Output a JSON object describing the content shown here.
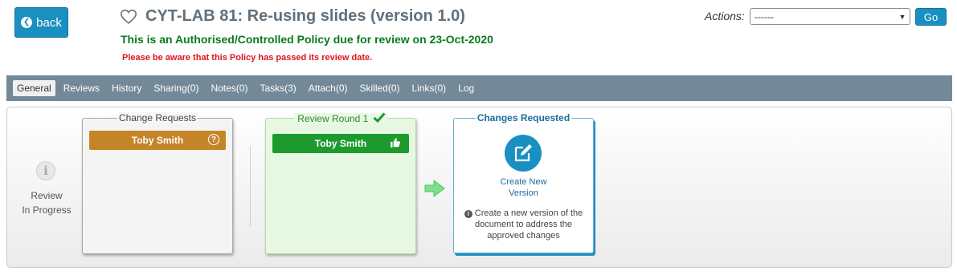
{
  "header": {
    "back_label": "back",
    "title": "CYT-LAB 81: Re-using slides (version 1.0)",
    "policy_status": "This is an Authorised/Controlled Policy due for review on 23-Oct-2020",
    "warning": "Please be aware that this Policy has passed its review date."
  },
  "actions": {
    "label": "Actions:",
    "selected": "------",
    "go_label": "Go"
  },
  "tabs": [
    {
      "label": "General",
      "active": true
    },
    {
      "label": "Reviews"
    },
    {
      "label": "History"
    },
    {
      "label": "Sharing(0)"
    },
    {
      "label": "Notes(0)"
    },
    {
      "label": "Tasks(3)"
    },
    {
      "label": "Attach(0)"
    },
    {
      "label": "Skilled(0)"
    },
    {
      "label": "Links(0)"
    },
    {
      "label": "Log"
    }
  ],
  "status": {
    "icon_letter": "i",
    "line1": "Review",
    "line2": "In Progress"
  },
  "change_requests": {
    "legend": "Change Requests",
    "person": "Toby Smith",
    "icon": "question-circle-icon"
  },
  "review_round": {
    "legend": "Review Round 1",
    "person": "Toby Smith",
    "icon": "thumbs-up-icon"
  },
  "changes_requested": {
    "legend": "Changes Requested",
    "action_title_line1": "Create New",
    "action_title_line2": "Version",
    "description": "Create a new version of the document to address the approved changes"
  },
  "colors": {
    "primary": "#1a8fc2",
    "success": "#0a7a1e",
    "danger": "#e0141e",
    "tabbar": "#738997",
    "chip_orange": "#c48528",
    "chip_green": "#1c9a2e"
  }
}
